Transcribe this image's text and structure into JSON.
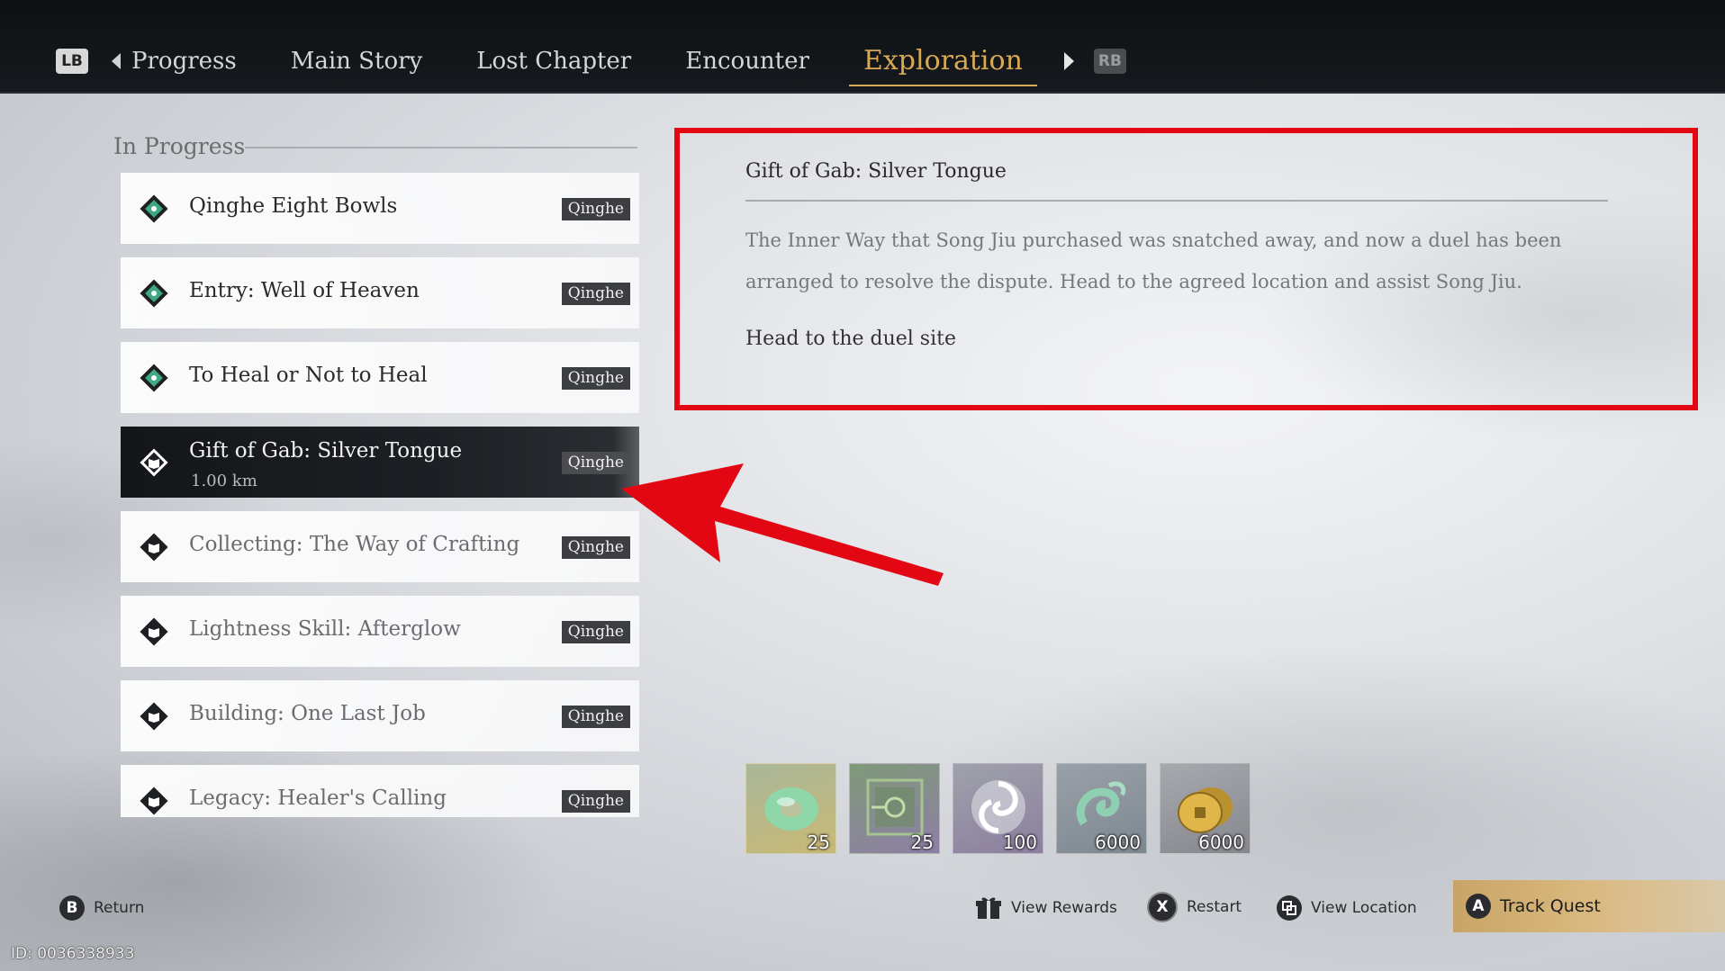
{
  "header": {
    "left_bumper": "LB",
    "right_bumper": "RB",
    "tabs": [
      {
        "label": "Progress"
      },
      {
        "label": "Main Story"
      },
      {
        "label": "Lost Chapter"
      },
      {
        "label": "Encounter"
      },
      {
        "label": "Exploration"
      }
    ],
    "active_tab": "Exploration"
  },
  "quest_list": {
    "section_label": "In Progress",
    "items": [
      {
        "title": "Qinghe Eight Bowls",
        "region": "Qinghe"
      },
      {
        "title": "Entry: Well of Heaven",
        "region": "Qinghe"
      },
      {
        "title": "To Heal or Not to Heal",
        "region": "Qinghe"
      },
      {
        "title": "Gift of Gab: Silver Tongue",
        "region": "Qinghe",
        "distance": "1.00 km",
        "selected": true
      },
      {
        "title": "Collecting: The Way of Crafting",
        "region": "Qinghe"
      },
      {
        "title": "Lightness Skill: Afterglow",
        "region": "Qinghe"
      },
      {
        "title": "Building: One Last Job",
        "region": "Qinghe"
      },
      {
        "title": "Legacy: Healer's Calling",
        "region": "Qinghe"
      }
    ]
  },
  "detail": {
    "title": "Gift of Gab: Silver Tongue",
    "description": "The Inner Way that Song Jiu purchased was snatched away, and now a duel has been arranged to resolve the dispute. Head to the agreed location and assist Song Jiu.",
    "objective": "Head to the duel site"
  },
  "rewards": [
    {
      "icon": "jade-ring-icon",
      "quantity": "25"
    },
    {
      "icon": "sealed-box-icon",
      "quantity": "25"
    },
    {
      "icon": "swirl-orb-icon",
      "quantity": "100"
    },
    {
      "icon": "jade-cloud-icon",
      "quantity": "6000"
    },
    {
      "icon": "coins-icon",
      "quantity": "6000"
    }
  ],
  "footer": {
    "return": {
      "key": "B",
      "label": "Return"
    },
    "view_rewards": {
      "label": "View Rewards"
    },
    "restart": {
      "key": "X",
      "label": "Restart"
    },
    "view_location": {
      "label": "View Location"
    },
    "track_quest": {
      "key": "A",
      "label": "Track Quest"
    },
    "id_text": "ID: 0036338933"
  },
  "colors": {
    "accent": "#d8a954",
    "annotation_red": "#e30613",
    "topbar": "#12161a"
  }
}
